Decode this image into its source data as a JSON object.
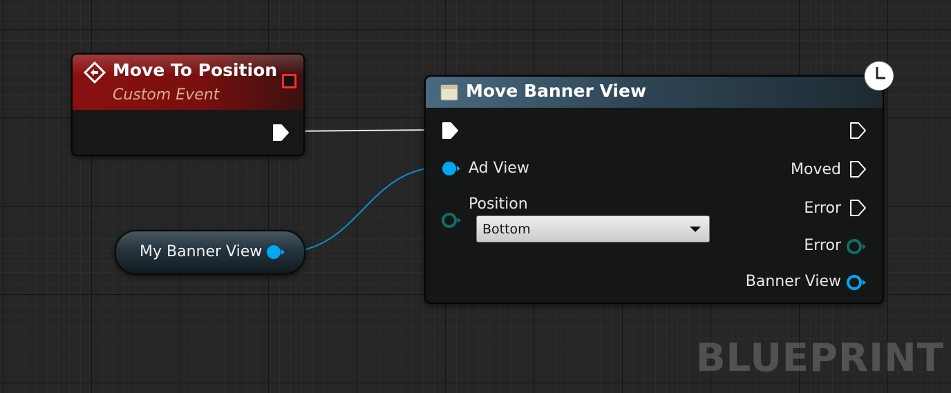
{
  "event_node": {
    "title": "Move To Position",
    "subtitle": "Custom Event",
    "header_color": "#8a1010",
    "icon": "custom-event-icon"
  },
  "function_node": {
    "title": "Move Banner View",
    "header_color": "#4a6a80",
    "icon": "function-icon",
    "latent_icon": "clock-icon",
    "inputs": {
      "ad_view_label": "Ad View",
      "position_label": "Position",
      "position_value": "Bottom"
    },
    "outputs": {
      "moved_label": "Moved",
      "error_exec_label": "Error",
      "error_data_label": "Error",
      "banner_view_label": "Banner View"
    }
  },
  "variable_node": {
    "label": "My Banner View"
  },
  "watermark": "BLUEPRINT",
  "colors": {
    "exec_pin": "#ffffff",
    "object_pin": "#00a8f4",
    "struct_pin": "#0f6e6a",
    "delegate_pin": "#ff2a2a"
  }
}
